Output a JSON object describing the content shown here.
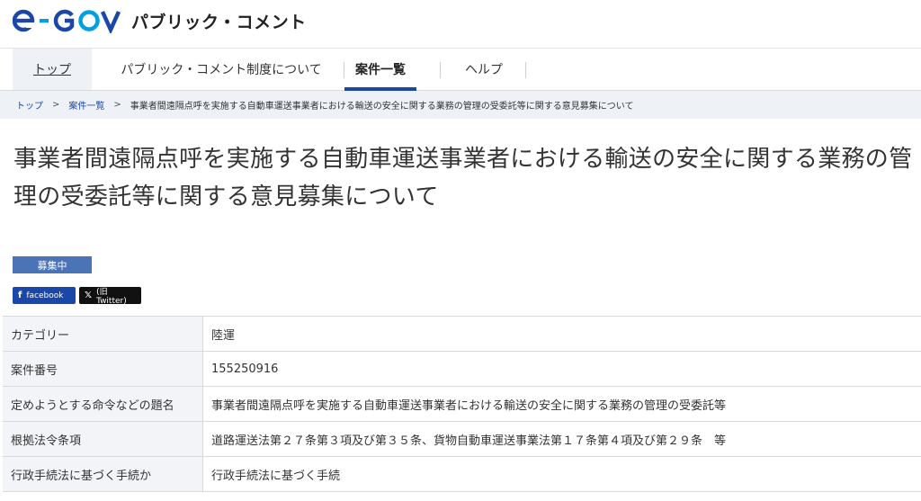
{
  "header": {
    "logo_text": "パブリック・コメント"
  },
  "nav": {
    "items": [
      {
        "label": "トップ"
      },
      {
        "label": "パブリック・コメント制度について"
      },
      {
        "label": "案件一覧"
      },
      {
        "label": "ヘルプ"
      }
    ]
  },
  "breadcrumb": {
    "items": [
      "トップ",
      "案件一覧",
      "事業者間遠隔点呼を実施する自動車運送事業者における輸送の安全に関する業務の管理の受委託等に関する意見募集について"
    ],
    "separator": ">"
  },
  "page": {
    "title": "事業者間遠隔点呼を実施する自動車運送事業者における輸送の安全に関する業務の管理の受委託等に関する意見募集について",
    "status_badge": "募集中"
  },
  "share": {
    "facebook_label": "facebook",
    "twitter_label": "(旧Twitter)"
  },
  "details": {
    "rows": [
      {
        "key": "カテゴリー",
        "value": "陸運"
      },
      {
        "key": "案件番号",
        "value": "155250916"
      },
      {
        "key": "定めようとする命令などの題名",
        "value": "事業者間遠隔点呼を実施する自動車運送事業者における輸送の安全に関する業務の管理の受委託等"
      },
      {
        "key": "根拠法令条項",
        "value": "道路運送法第２７条第３項及び第３５条、貨物自動車運送事業法第１７条第４項及び第２９条　等"
      },
      {
        "key": "行政手続法に基づく手続か",
        "value": "行政手続法に基づく手続"
      }
    ]
  },
  "colors": {
    "brand_blue": "#1a47a8",
    "accent_cyan": "#00a0e0",
    "badge_blue": "#4a74b6"
  }
}
